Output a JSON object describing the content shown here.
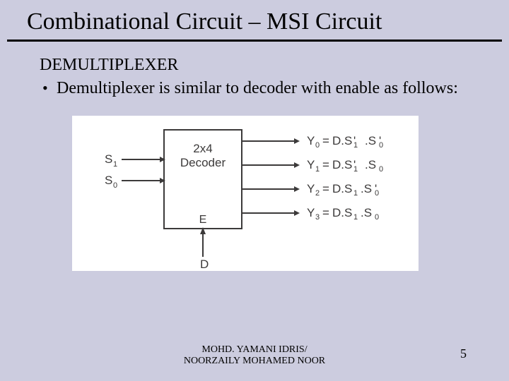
{
  "title": "Combinational Circuit – MSI Circuit",
  "subheading": "DEMULTIPLEXER",
  "bullet": "Demultiplexer is similar to decoder with enable as follows:",
  "diagram": {
    "block_line1": "2x4",
    "block_line2": "Decoder",
    "enable_label": "E",
    "data_input": "D",
    "select": [
      "S",
      "S"
    ],
    "select_sub": [
      "1",
      "0"
    ],
    "outputs": [
      {
        "name": "Y",
        "sub": "0",
        "expr": "D.S",
        "terms": [
          {
            "t": "1",
            "bar": true
          },
          {
            "t": "0",
            "bar": true
          }
        ]
      },
      {
        "name": "Y",
        "sub": "1",
        "expr": "D.S",
        "terms": [
          {
            "t": "1",
            "bar": true
          },
          {
            "t": "0",
            "bar": false
          }
        ]
      },
      {
        "name": "Y",
        "sub": "2",
        "expr": "D.S",
        "terms": [
          {
            "t": "1",
            "bar": false
          },
          {
            "t": "0",
            "bar": true
          }
        ]
      },
      {
        "name": "Y",
        "sub": "3",
        "expr": "D.S",
        "terms": [
          {
            "t": "1",
            "bar": false
          },
          {
            "t": "0",
            "bar": false
          }
        ]
      }
    ]
  },
  "footer": {
    "l1": "MOHD. YAMANI IDRIS/",
    "l2": "NOORZAILY MOHAMED NOOR"
  },
  "page": "5"
}
